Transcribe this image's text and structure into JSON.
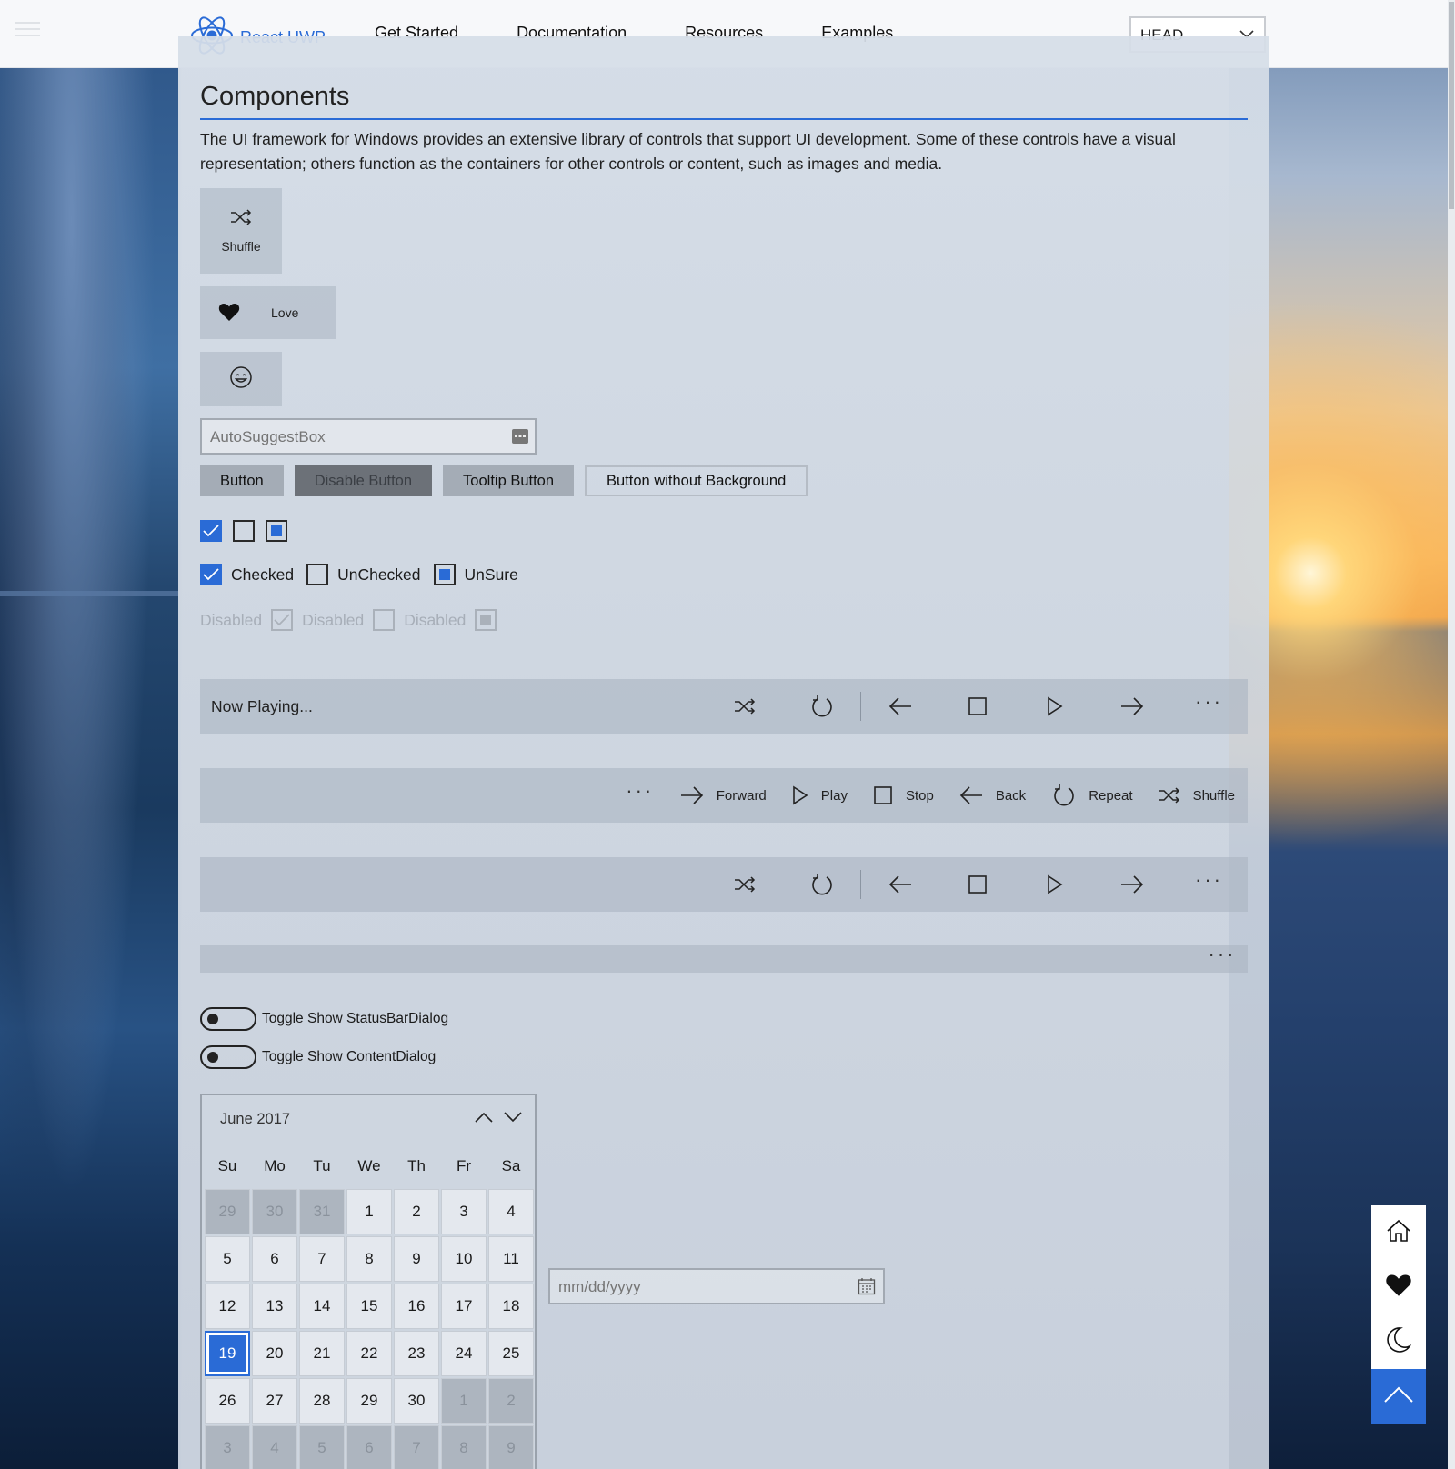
{
  "nav": {
    "brand": "React UWP",
    "links": [
      "Get Started",
      "Documentation",
      "Resources",
      "Examples"
    ],
    "branch_select": "HEAD"
  },
  "page": {
    "title": "Components",
    "intro": "The UI framework for Windows provides an extensive library of controls that support UI development. Some of these controls have a visual representation; others function as the containers for other controls or content, such as images and media."
  },
  "app_buttons": {
    "shuffle_label": "Shuffle",
    "love_label": "Love"
  },
  "auto_suggest": {
    "placeholder": "AutoSuggestBox"
  },
  "buttons": {
    "button": "Button",
    "disabled": "Disable Button",
    "tooltip": "Tooltip Button",
    "no_background": "Button without Background"
  },
  "checkboxes": {
    "checked": "Checked",
    "unchecked": "UnChecked",
    "unsure": "UnSure",
    "disabled": "Disabled"
  },
  "command_bars": {
    "now_playing": "Now Playing...",
    "forward": "Forward",
    "play": "Play",
    "stop": "Stop",
    "back": "Back",
    "repeat": "Repeat",
    "shuffle": "Shuffle",
    "more": "···"
  },
  "toggles": {
    "status_bar": "Toggle Show StatusBarDialog",
    "content_dialog": "Toggle Show ContentDialog"
  },
  "calendar": {
    "month": "June 2017",
    "weekdays": [
      "Su",
      "Mo",
      "Tu",
      "We",
      "Th",
      "Fr",
      "Sa"
    ],
    "days": [
      {
        "d": "29",
        "other": true
      },
      {
        "d": "30",
        "other": true
      },
      {
        "d": "31",
        "other": true
      },
      {
        "d": "1"
      },
      {
        "d": "2"
      },
      {
        "d": "3"
      },
      {
        "d": "4"
      },
      {
        "d": "5"
      },
      {
        "d": "6"
      },
      {
        "d": "7"
      },
      {
        "d": "8"
      },
      {
        "d": "9"
      },
      {
        "d": "10"
      },
      {
        "d": "11"
      },
      {
        "d": "12"
      },
      {
        "d": "13"
      },
      {
        "d": "14"
      },
      {
        "d": "15"
      },
      {
        "d": "16"
      },
      {
        "d": "17"
      },
      {
        "d": "18"
      },
      {
        "d": "19",
        "selected": true
      },
      {
        "d": "20"
      },
      {
        "d": "21"
      },
      {
        "d": "22"
      },
      {
        "d": "23"
      },
      {
        "d": "24"
      },
      {
        "d": "25"
      },
      {
        "d": "26"
      },
      {
        "d": "27"
      },
      {
        "d": "28"
      },
      {
        "d": "29"
      },
      {
        "d": "30"
      },
      {
        "d": "1",
        "other": true
      },
      {
        "d": "2",
        "other": true
      },
      {
        "d": "3",
        "other": true
      },
      {
        "d": "4",
        "other": true
      },
      {
        "d": "5",
        "other": true
      },
      {
        "d": "6",
        "other": true
      },
      {
        "d": "7",
        "other": true
      },
      {
        "d": "8",
        "other": true
      },
      {
        "d": "9",
        "other": true
      }
    ]
  },
  "date_input": {
    "placeholder": "mm/dd/yyyy"
  },
  "colors": {
    "accent": "#2a6bd6"
  }
}
